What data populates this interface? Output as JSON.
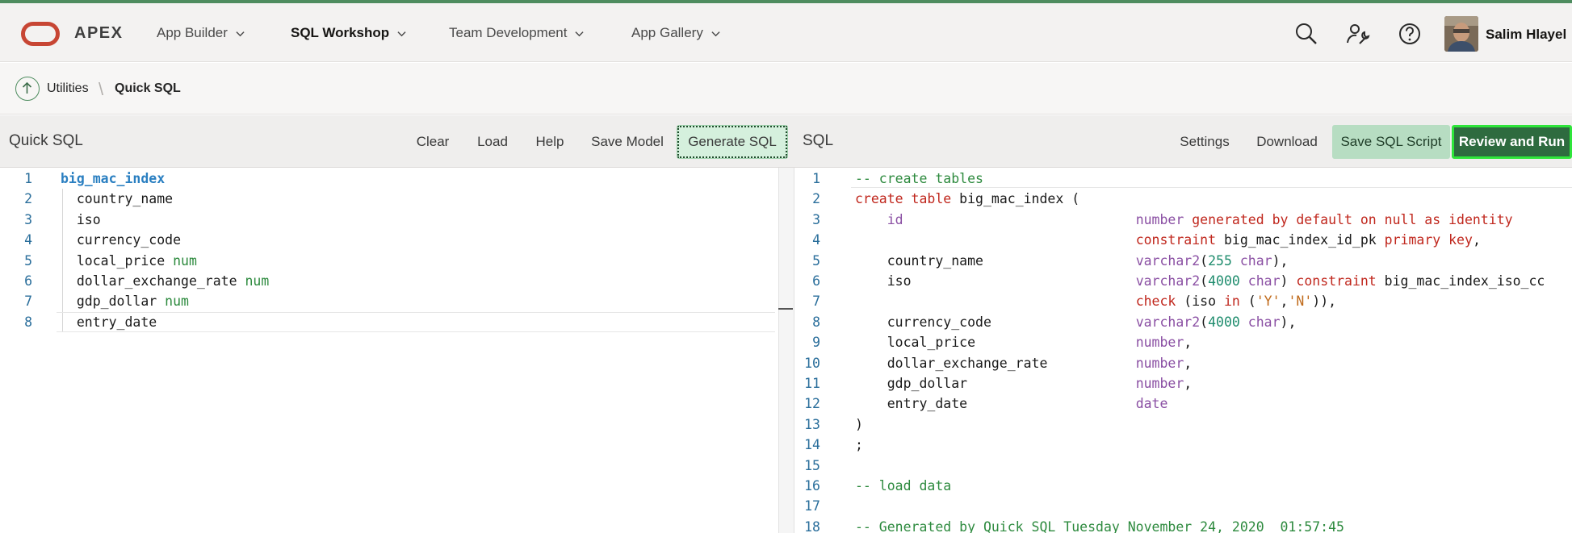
{
  "header": {
    "brand": "APEX",
    "nav": [
      {
        "label": "App Builder",
        "active": false
      },
      {
        "label": "SQL Workshop",
        "active": true
      },
      {
        "label": "Team Development",
        "active": false
      },
      {
        "label": "App Gallery",
        "active": false
      }
    ],
    "icons": [
      "search-icon",
      "wrench-user-icon",
      "help-icon"
    ],
    "user_name": "Salim Hlayel"
  },
  "breadcrumb": {
    "parent": "Utilities",
    "current": "Quick SQL"
  },
  "left_panel": {
    "title": "Quick SQL",
    "buttons": [
      "Clear",
      "Load",
      "Help",
      "Save Model",
      "Generate SQL"
    ],
    "lines": [
      {
        "n": "1",
        "parts": [
          {
            "t": "big_mac_index",
            "c": "kw-blue"
          }
        ]
      },
      {
        "n": "2",
        "parts": [
          {
            "t": "  country_name",
            "c": ""
          }
        ]
      },
      {
        "n": "3",
        "parts": [
          {
            "t": "  iso",
            "c": ""
          }
        ]
      },
      {
        "n": "4",
        "parts": [
          {
            "t": "  currency_code",
            "c": ""
          }
        ]
      },
      {
        "n": "5",
        "parts": [
          {
            "t": "  local_price ",
            "c": ""
          },
          {
            "t": "num",
            "c": "green"
          }
        ]
      },
      {
        "n": "6",
        "parts": [
          {
            "t": "  dollar_exchange_rate ",
            "c": ""
          },
          {
            "t": "num",
            "c": "green"
          }
        ]
      },
      {
        "n": "7",
        "parts": [
          {
            "t": "  gdp_dollar ",
            "c": ""
          },
          {
            "t": "num",
            "c": "green"
          }
        ]
      },
      {
        "n": "8",
        "parts": [
          {
            "t": "  entry_date",
            "c": ""
          }
        ]
      }
    ]
  },
  "right_panel": {
    "title": "SQL",
    "buttons": [
      "Settings",
      "Download",
      "Save SQL Script",
      "Review and Run"
    ],
    "lines": [
      {
        "n": "1",
        "parts": [
          {
            "t": "-- create tables",
            "c": "green"
          }
        ]
      },
      {
        "n": "2",
        "parts": [
          {
            "t": "create table",
            "c": "red"
          },
          {
            "t": " big_mac_index (",
            "c": ""
          }
        ]
      },
      {
        "n": "3",
        "parts": [
          {
            "t": "    id                             ",
            "c": "purple"
          },
          {
            "t": "number",
            "c": "purple"
          },
          {
            "t": " generated by default on null as identity",
            "c": "red"
          }
        ]
      },
      {
        "n": "4",
        "parts": [
          {
            "t": "                                   ",
            "c": ""
          },
          {
            "t": "constraint",
            "c": "red"
          },
          {
            "t": " big_mac_index_id_pk ",
            "c": ""
          },
          {
            "t": "primary key",
            "c": "red"
          },
          {
            "t": ",",
            "c": ""
          }
        ]
      },
      {
        "n": "5",
        "parts": [
          {
            "t": "    country_name                   ",
            "c": ""
          },
          {
            "t": "varchar2",
            "c": "purple"
          },
          {
            "t": "(",
            "c": ""
          },
          {
            "t": "255",
            "c": "teal"
          },
          {
            "t": " char",
            "c": "purple"
          },
          {
            "t": "),",
            "c": ""
          }
        ]
      },
      {
        "n": "6",
        "parts": [
          {
            "t": "    iso                            ",
            "c": ""
          },
          {
            "t": "varchar2",
            "c": "purple"
          },
          {
            "t": "(",
            "c": ""
          },
          {
            "t": "4000",
            "c": "teal"
          },
          {
            "t": " char",
            "c": "purple"
          },
          {
            "t": ") ",
            "c": ""
          },
          {
            "t": "constraint",
            "c": "red"
          },
          {
            "t": " big_mac_index_iso_cc",
            "c": ""
          }
        ]
      },
      {
        "n": "7",
        "parts": [
          {
            "t": "                                   ",
            "c": ""
          },
          {
            "t": "check",
            "c": "red"
          },
          {
            "t": " (iso ",
            "c": ""
          },
          {
            "t": "in",
            "c": "red"
          },
          {
            "t": " (",
            "c": ""
          },
          {
            "t": "'Y'",
            "c": "orange"
          },
          {
            "t": ",",
            "c": ""
          },
          {
            "t": "'N'",
            "c": "orange"
          },
          {
            "t": ")),",
            "c": ""
          }
        ]
      },
      {
        "n": "8",
        "parts": [
          {
            "t": "    currency_code                  ",
            "c": ""
          },
          {
            "t": "varchar2",
            "c": "purple"
          },
          {
            "t": "(",
            "c": ""
          },
          {
            "t": "4000",
            "c": "teal"
          },
          {
            "t": " char",
            "c": "purple"
          },
          {
            "t": "),",
            "c": ""
          }
        ]
      },
      {
        "n": "9",
        "parts": [
          {
            "t": "    local_price                    ",
            "c": ""
          },
          {
            "t": "number",
            "c": "purple"
          },
          {
            "t": ",",
            "c": ""
          }
        ]
      },
      {
        "n": "10",
        "parts": [
          {
            "t": "    dollar_exchange_rate           ",
            "c": ""
          },
          {
            "t": "number",
            "c": "purple"
          },
          {
            "t": ",",
            "c": ""
          }
        ]
      },
      {
        "n": "11",
        "parts": [
          {
            "t": "    gdp_dollar                     ",
            "c": ""
          },
          {
            "t": "number",
            "c": "purple"
          },
          {
            "t": ",",
            "c": ""
          }
        ]
      },
      {
        "n": "12",
        "parts": [
          {
            "t": "    entry_date                     ",
            "c": ""
          },
          {
            "t": "date",
            "c": "purple"
          }
        ]
      },
      {
        "n": "13",
        "parts": [
          {
            "t": ")",
            "c": ""
          }
        ]
      },
      {
        "n": "14",
        "parts": [
          {
            "t": ";",
            "c": ""
          }
        ]
      },
      {
        "n": "15",
        "parts": [
          {
            "t": "",
            "c": ""
          }
        ]
      },
      {
        "n": "16",
        "parts": [
          {
            "t": "-- load data",
            "c": "green"
          }
        ]
      },
      {
        "n": "17",
        "parts": [
          {
            "t": "",
            "c": ""
          }
        ]
      },
      {
        "n": "18",
        "parts": [
          {
            "t": "-- Generated by Quick SQL Tuesday November 24, 2020  01:57:45",
            "c": "green"
          }
        ]
      }
    ]
  },
  "colors": {
    "brand_red": "#c74634",
    "accent_green": "#2e6b3f",
    "highlight_green": "#2ee53a"
  }
}
